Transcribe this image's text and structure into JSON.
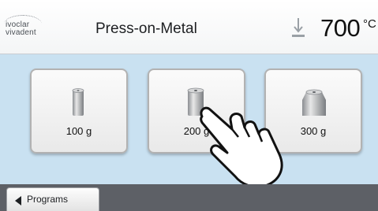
{
  "header": {
    "logo_line1": "ivoclar",
    "logo_line2": "vivadent",
    "title": "Press-on-Metal",
    "temperature_value": "700",
    "temperature_unit": "°C",
    "temperature_icon": "thermometer-arrow-down-icon"
  },
  "tiles": [
    {
      "label": "100 g",
      "icon": "small-ingot-icon"
    },
    {
      "label": "200 g",
      "icon": "medium-ingot-icon"
    },
    {
      "label": "300 g",
      "icon": "large-ingot-icon"
    }
  ],
  "overlay": {
    "icon": "pointing-hand-icon"
  },
  "footer": {
    "back_label": "Programs",
    "back_icon": "triangle-left-icon"
  },
  "colors": {
    "content_bg": "#c9e1f1",
    "footer_bg": "#5d6066"
  }
}
